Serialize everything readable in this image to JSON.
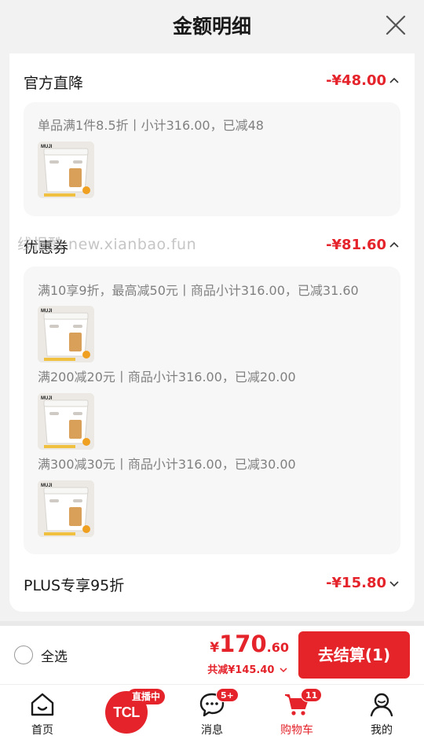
{
  "header": {
    "title": "金额明细"
  },
  "sections": [
    {
      "name": "官方直降",
      "amount": "-¥48.00",
      "rules": [
        "单品满1件8.5折丨小计316.00，已减48"
      ]
    },
    {
      "name": "优惠券",
      "amount": "-¥81.60",
      "rules": [
        "满10享9折，最高减50元丨商品小计316.00，已减31.60",
        "满200减20元丨商品小计316.00，已减20.00",
        "满300减30元丨商品小计316.00，已减30.00"
      ]
    },
    {
      "name": "PLUS专享95折",
      "amount": "-¥15.80"
    }
  ],
  "product_thumb": {
    "brand": "MUJI",
    "icon": "storage-box-image"
  },
  "watermark": "线报酷 new.xianbao.fun",
  "bottom_bar": {
    "select_all": "全选",
    "total_currency": "¥",
    "total_int": "170",
    "total_dec": ".60",
    "saved": "共减¥145.40",
    "checkout": "去结算(1)"
  },
  "tabbar": {
    "home": "首页",
    "live_badge": "直播中",
    "live_logo": "TCL",
    "messages": "消息",
    "messages_badge": "5+",
    "cart": "购物车",
    "cart_badge": "11",
    "mine": "我的"
  },
  "colors": {
    "accent": "#e4232b",
    "background": "#f2f2f2"
  }
}
